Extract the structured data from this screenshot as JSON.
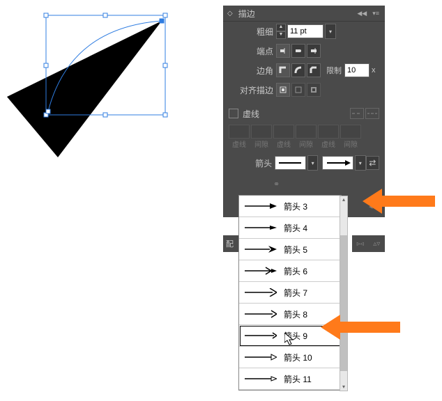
{
  "panel": {
    "title": "描边",
    "weight_label": "粗细",
    "weight_value": "11 pt",
    "cap_label": "端点",
    "corner_label": "边角",
    "limit_label": "限制",
    "limit_value": "10",
    "limit_unit": "x",
    "align_label": "对齐描边",
    "dashed_label": "虚线",
    "dash_field_labels": [
      "虚线",
      "间隙",
      "虚线",
      "间隙",
      "虚线",
      "间隙"
    ],
    "arrow_label": "箭头",
    "profile_label": "配",
    "icons": {
      "cap_butt": "cap-butt-icon",
      "cap_round": "cap-round-icon",
      "cap_projecting": "cap-projecting-icon",
      "corner_miter": "corner-miter-icon",
      "corner_round": "corner-round-icon",
      "corner_bevel": "corner-bevel-icon",
      "align_center": "align-stroke-center-icon",
      "align_inside": "align-stroke-inside-icon",
      "align_outside": "align-stroke-outside-icon",
      "swap": "swap-arrowheads-icon"
    }
  },
  "dropdown": {
    "items": [
      {
        "label": "箭头 3",
        "variant": 3
      },
      {
        "label": "箭头 4",
        "variant": 4
      },
      {
        "label": "箭头 5",
        "variant": 5
      },
      {
        "label": "箭头 6",
        "variant": 6
      },
      {
        "label": "箭头 7",
        "variant": 7
      },
      {
        "label": "箭头 8",
        "variant": 8
      },
      {
        "label": "箭头 9",
        "variant": 9,
        "selected": true
      },
      {
        "label": "箭头 10",
        "variant": 10
      },
      {
        "label": "箭头 11",
        "variant": 11
      }
    ]
  },
  "colors": {
    "panel_bg": "#4a4a4a",
    "panel_text": "#c8c8c8",
    "accent_orange": "#ff7a1a",
    "selection_blue": "#2f7de1"
  }
}
